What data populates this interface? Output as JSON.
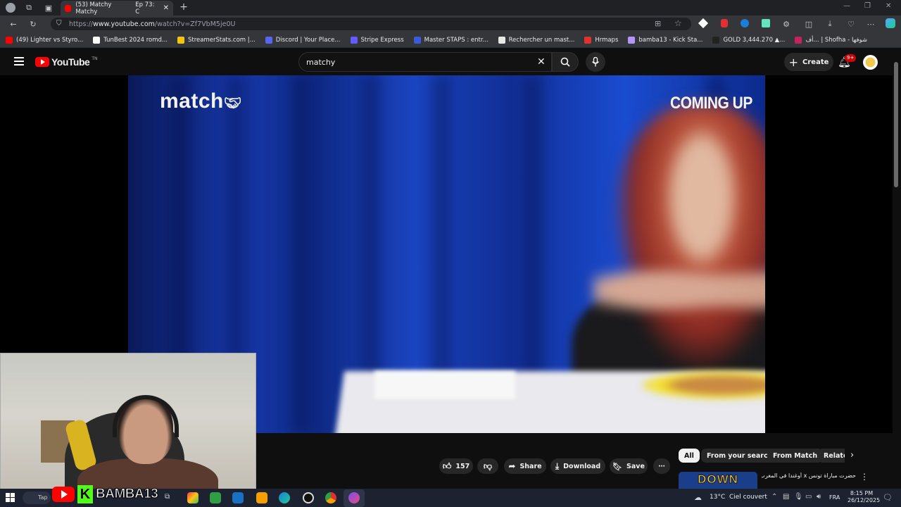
{
  "browser": {
    "tab_title": "(53) Matchy Matchy",
    "tab_title_suffix": "Ep 73: C",
    "url_prefix": "https://",
    "url_domain": "www.youtube.com",
    "url_path": "/watch?v=Zf7VbM5je0U",
    "bookmarks": [
      {
        "label": "(49) Lighter vs Styro...",
        "color": "#ff0000"
      },
      {
        "label": "TunBest 2024 romd...",
        "color": "#ffffff"
      },
      {
        "label": "StreamerStats.com |...",
        "color": "#f2c40f"
      },
      {
        "label": "Discord | Your Place...",
        "color": "#5865f2"
      },
      {
        "label": "Stripe Express",
        "color": "#635bff"
      },
      {
        "label": "Master STAPS : entr...",
        "color": "#3b5bdb"
      },
      {
        "label": "Rechercher un mast...",
        "color": "#e8e8e8"
      },
      {
        "label": "Hrmaps",
        "color": "#e03131"
      },
      {
        "label": "bamba13 - Kick Sta...",
        "color": "#b197fc"
      },
      {
        "label": "GOLD 3,444.270 ▲...",
        "color": "#222222"
      },
      {
        "label": "أف... | Shofha - شوفها",
        "color": "#c2255c"
      }
    ]
  },
  "youtube": {
    "logo_text": "YouTube",
    "logo_region": "TN",
    "search_value": "matchy",
    "create_label": "Create",
    "notification_count": "9+",
    "video": {
      "logo_overlay": "match",
      "corner_text": "COMING UP"
    },
    "actions": {
      "like_count": "157",
      "share_label": "Share",
      "download_label": "Download",
      "save_label": "Save"
    },
    "chips": [
      "All",
      "From your search",
      "From Match",
      "Relate"
    ],
    "recommended": {
      "thumbnail_text": "DOWN",
      "title": "حضرت مباراة تونس x أوغندا في المغرب..."
    }
  },
  "stream_overlay": {
    "channel_name": "BAMBA13",
    "k_letter": "K"
  },
  "taskbar": {
    "search_text": "Tap",
    "weather": "13°C  Ciel couvert",
    "language": "FRA",
    "time": "8:15 PM",
    "date": "26/12/2025"
  }
}
